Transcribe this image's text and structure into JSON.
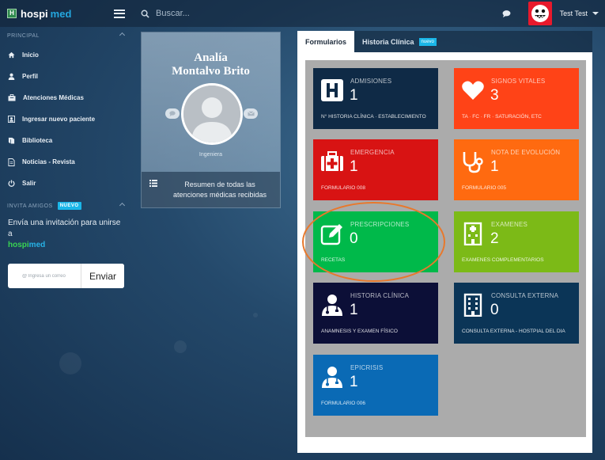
{
  "brand": {
    "name1": "hospi",
    "name2": "med"
  },
  "search": {
    "placeholder": "Buscar..."
  },
  "user": {
    "name": "Test Test"
  },
  "sidebar": {
    "section_principal": "PRINCIPAL",
    "items": [
      {
        "label": "Inicio",
        "icon": "home-icon"
      },
      {
        "label": "Perfil",
        "icon": "user-icon"
      },
      {
        "label": "Atenciones Médicas",
        "icon": "briefcase-icon"
      },
      {
        "label": "Ingresar nuevo paciente",
        "icon": "add-patient-icon"
      },
      {
        "label": "Biblioteca",
        "icon": "book-icon"
      },
      {
        "label": "Noticias - Revista",
        "icon": "news-icon"
      },
      {
        "label": "Salir",
        "icon": "power-icon"
      }
    ],
    "section_invite": "INVITA AMIGOS",
    "invite_badge": "NUEVO",
    "invite_text": "Envía una invitación para unirse a",
    "invite_brand1": "hospi",
    "invite_brand2": "med",
    "invite_placeholder": "@ Ingresa un correo",
    "invite_button": "Enviar"
  },
  "profile": {
    "first_name": "Analía",
    "last_name": "Montalvo Brito",
    "role": "Ingeniera",
    "summary": "Resumen de todas las atenciones médicas recibidas"
  },
  "tabs": [
    {
      "label": "Formularios"
    },
    {
      "label": "Historia Clínica",
      "badge": "nuevo"
    }
  ],
  "tiles": [
    {
      "title": "ADMISIONES",
      "count": "1",
      "sub": "N° HISTORIA CLÍNICA · ESTABLECIMIENTO",
      "color": "#0f2a46",
      "icon": "hospital-icon"
    },
    {
      "title": "SIGNOS VITALES",
      "count": "3",
      "sub": "TA · FC · FR · SATURACIÓN, ETC",
      "color": "#ff4317",
      "icon": "heart-icon"
    },
    {
      "title": "EMERGENCIA",
      "count": "1",
      "sub": "FORMULARIO 008",
      "color": "#d81313",
      "icon": "first-aid-kit-icon"
    },
    {
      "title": "NOTA DE EVOLUCIÓN",
      "count": "1",
      "sub": "FORMULARIO 005",
      "color": "#ff6a10",
      "icon": "stethoscope-icon"
    },
    {
      "title": "PRESCRIPCIONES",
      "count": "0",
      "sub": "RECETAS",
      "color": "#00b94a",
      "icon": "edit-icon"
    },
    {
      "title": "EXAMENES",
      "count": "2",
      "sub": "EXAMENES COMPLEMENTARIOS",
      "color": "#7cba17",
      "icon": "lab-building-icon"
    },
    {
      "title": "HISTORIA CLÍNICA",
      "count": "1",
      "sub": "ANAMNESIS Y EXAMEN FÍSICO",
      "color": "#0c0f37",
      "icon": "doctor-icon"
    },
    {
      "title": "CONSULTA EXTERNA",
      "count": "0",
      "sub": "CONSULTA EXTERNA - HOSTPIAL DEL DIA",
      "color": "#0b3557",
      "icon": "building-icon"
    },
    {
      "title": "EPICRISIS",
      "count": "1",
      "sub": "FORMULARIO 006",
      "color": "#0a6ab5",
      "icon": "doctor-icon"
    }
  ]
}
